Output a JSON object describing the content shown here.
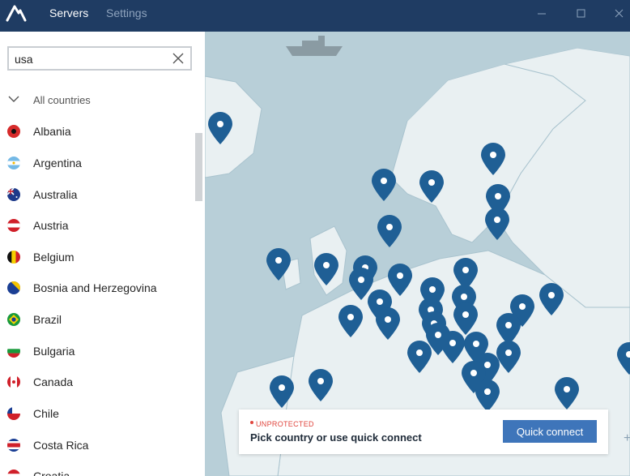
{
  "header": {
    "tabs": [
      {
        "label": "Servers",
        "active": true
      },
      {
        "label": "Settings",
        "active": false
      }
    ],
    "icons": [
      "nordvpn-logo-icon",
      "minimize-icon",
      "maximize-icon",
      "close-icon"
    ]
  },
  "search": {
    "value": "usa"
  },
  "list": {
    "all_label": "All countries",
    "countries": [
      {
        "name": "Albania"
      },
      {
        "name": "Argentina"
      },
      {
        "name": "Australia"
      },
      {
        "name": "Austria"
      },
      {
        "name": "Belgium"
      },
      {
        "name": "Bosnia and Herzegovina"
      },
      {
        "name": "Brazil"
      },
      {
        "name": "Bulgaria"
      },
      {
        "name": "Canada"
      },
      {
        "name": "Chile"
      },
      {
        "name": "Costa Rica"
      },
      {
        "name": "Croatia"
      }
    ]
  },
  "status": {
    "label": "UNPROTECTED",
    "message": "Pick country or use quick connect",
    "button": "Quick connect"
  },
  "colors": {
    "titlebar": "#1f3c63",
    "water": "#b8cfd8",
    "land": "#e9f0f2",
    "pin": "#1f5f95",
    "accent": "#3e75ba",
    "warning": "#e0453d"
  },
  "map": {
    "zoom_in": "+"
  }
}
